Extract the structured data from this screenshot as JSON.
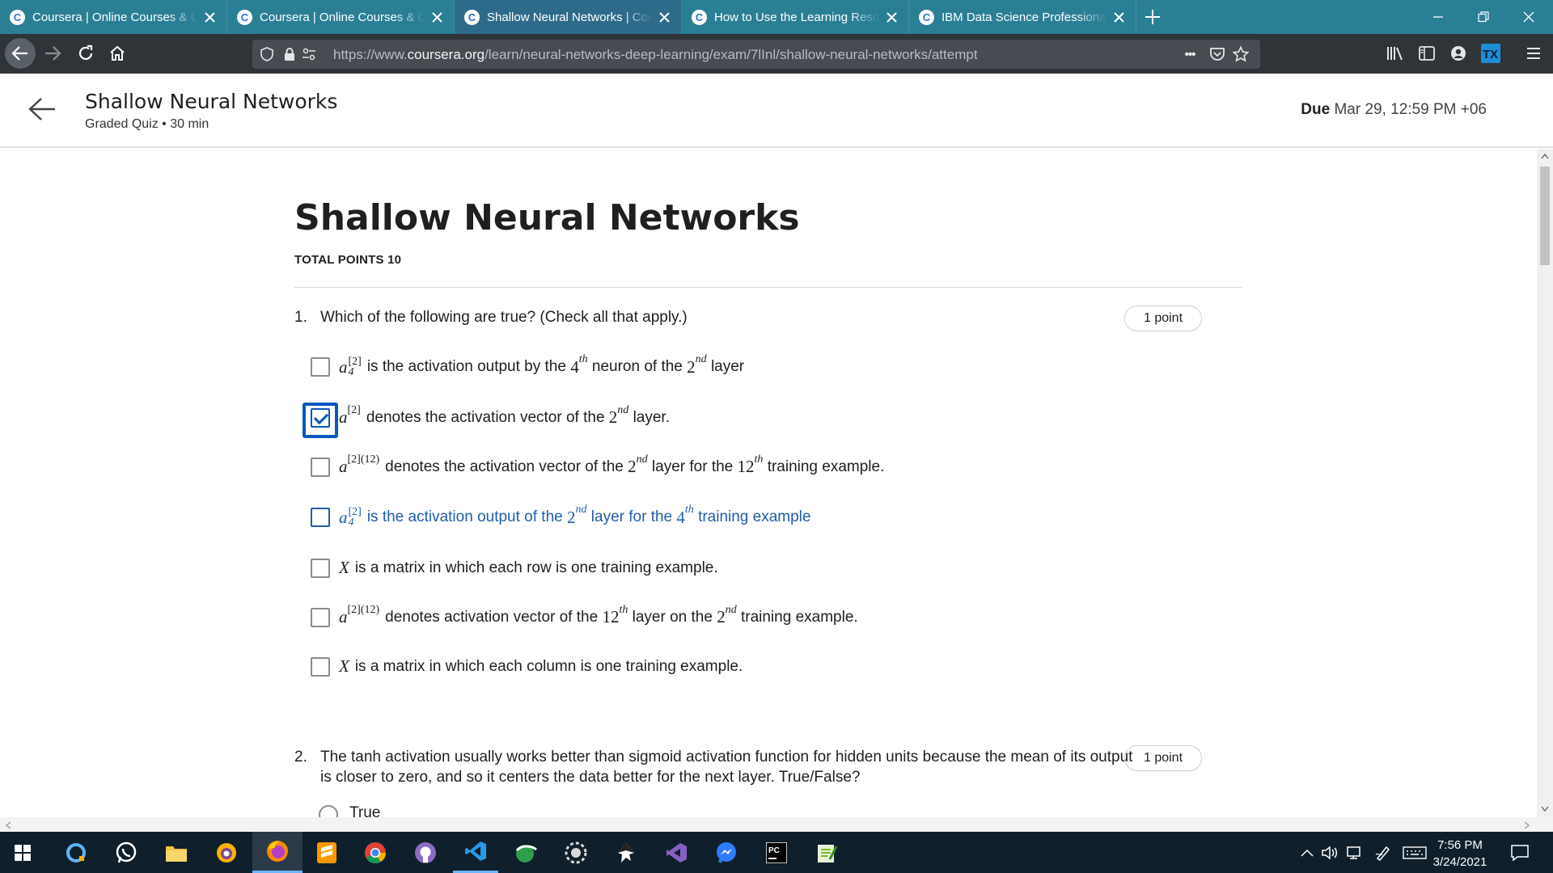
{
  "browser": {
    "tabs": [
      {
        "label": "Coursera | Online Courses & Credentials From Top Educators",
        "active": false
      },
      {
        "label": "Coursera | Online Courses & Credentials From Top Educators",
        "active": false
      },
      {
        "label": "Shallow Neural Networks | Coursera",
        "active": true
      },
      {
        "label": "How to Use the Learning Resources",
        "active": false
      },
      {
        "label": "IBM Data Science Professional Certificate",
        "active": false
      }
    ],
    "favicon_letter": "C",
    "url_prefix": "https://www.",
    "url_domain": "coursera.org",
    "url_path": "/learn/neural-networks-deep-learning/exam/7lInl/shallow-neural-networks/attempt",
    "more_label": "•••"
  },
  "header": {
    "title": "Shallow Neural Networks",
    "subtitle": "Graded Quiz • 30 min",
    "due_label": "Due",
    "due_value": "Mar 29, 12:59 PM +06"
  },
  "quiz": {
    "title": "Shallow Neural Networks",
    "total_points": "TOTAL POINTS 10",
    "questions": [
      {
        "number": "1.",
        "text": "Which of the following are true? (Check all that apply.)",
        "points": "1 point",
        "options": [
          {
            "math": {
              "base": "a",
              "sup": "[2]",
              "sub": "4"
            },
            "text": "is the activation output by the 4th neuron of the 2nd layer",
            "t1": "is the activation output by the",
            "n1": "4",
            "s1": "th",
            "t2": "neuron of the",
            "n2": "2",
            "s2": "nd",
            "t3": "layer",
            "checked": false
          },
          {
            "t0": "a",
            "sup0": "[2]",
            "t1": "denotes the activation vector of the",
            "n1": "2",
            "s1": "nd",
            "t2": "layer.",
            "checked": true
          },
          {
            "t0": "a",
            "sup0": "[2](12)",
            "t1": "denotes the activation vector of the",
            "n1": "2",
            "s1": "nd",
            "t2": "layer for the",
            "n2": "12",
            "s2": "th",
            "t3": "training example.",
            "checked": false
          },
          {
            "t0": "a",
            "supA": "[2]",
            "subA": "4",
            "t1": "is the activation output of the",
            "n1": "2",
            "s1": "nd",
            "t2": "layer for the",
            "n2": "4",
            "s2": "th",
            "t3": "training example",
            "checked": false,
            "hover": true
          },
          {
            "t0": "X",
            "t1": "is a matrix in which each row is one training example.",
            "checked": false
          },
          {
            "t0": "a",
            "sup0": "[2](12)",
            "t1": "denotes activation vector of the",
            "n1": "12",
            "s1": "th",
            "t2": "layer on the",
            "n2": "2",
            "s2": "nd",
            "t3": "training example.",
            "checked": false
          },
          {
            "t0": "X",
            "t1": "is a matrix in which each column is one training example.",
            "checked": false
          }
        ]
      },
      {
        "number": "2.",
        "text_line1": "The tanh activation usually works better than sigmoid activation function for hidden units because the mean of its output",
        "text_line2": "is closer to zero, and so it centers the data better for the next layer. True/False?",
        "points": "1 point",
        "first_option": "True"
      }
    ]
  },
  "taskbar": {
    "apps": [
      "windows-start",
      "cortana",
      "whatsapp",
      "file-explorer",
      "tor-browser",
      "firefox",
      "sublime",
      "chrome",
      "github-desktop",
      "vscode",
      "cleanmaster",
      "anaconda",
      "inkscape",
      "visual-studio",
      "messenger",
      "pycharm",
      "notepad-plus"
    ],
    "time": "7:56 PM",
    "date": "3/24/2021"
  },
  "colors": {
    "tab_bar": "#2a7f95",
    "nav_bar": "#2f3438",
    "link_blue": "#1e5ea8",
    "checkbox_checked": "#0a56c2",
    "taskbar": "#0f1f2b"
  }
}
